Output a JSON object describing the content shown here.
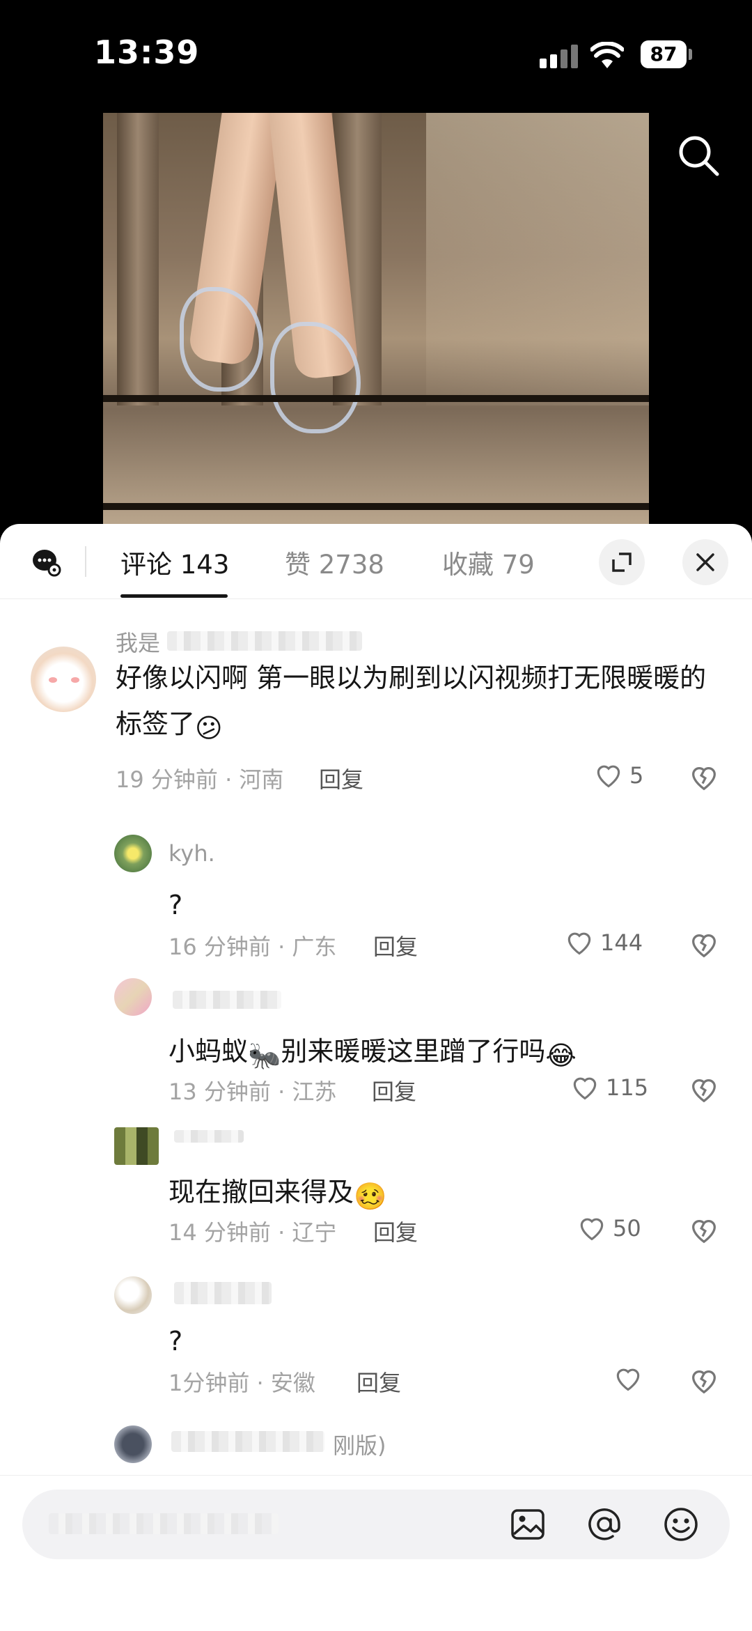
{
  "status_bar": {
    "time": "13:39",
    "battery": "87"
  },
  "video": {
    "search_icon": "search-icon"
  },
  "tabs": {
    "comments": "评论 143",
    "likes": "赞 2738",
    "favorites": "收藏 79"
  },
  "comments": [
    {
      "name": "我是",
      "text": "好像以闪啊 第一眼以为刷到以闪视频打无限暖暖的标签了",
      "emoji": "😕",
      "time_location": "19 分钟前 · 河南",
      "reply_label": "回复",
      "likes": "5"
    },
    {
      "name": "kyh.",
      "text": "?",
      "time_location": "16 分钟前 · 广东",
      "reply_label": "回复",
      "likes": "144"
    },
    {
      "name": "",
      "text_before": "小蚂蚁",
      "text_after": "别来暖暖这里蹭了行吗",
      "emoji_mid": "🐜",
      "emoji": "😂",
      "time_location": "13 分钟前 · 江苏",
      "reply_label": "回复",
      "likes": "115"
    },
    {
      "name": "",
      "text": "现在撤回来得及",
      "emoji": "🥴",
      "time_location": "14 分钟前 · 辽宁",
      "reply_label": "回复",
      "likes": "50"
    },
    {
      "name": "",
      "text": "?",
      "time_location": "1分钟前 · 安徽",
      "reply_label": "回复",
      "likes": ""
    },
    {
      "name": "刚版)"
    }
  ],
  "input": {
    "placeholder": ""
  },
  "colors": {
    "tab_active": "#161616",
    "muted": "#a3a3a3",
    "sheet_bg": "#ffffff"
  }
}
